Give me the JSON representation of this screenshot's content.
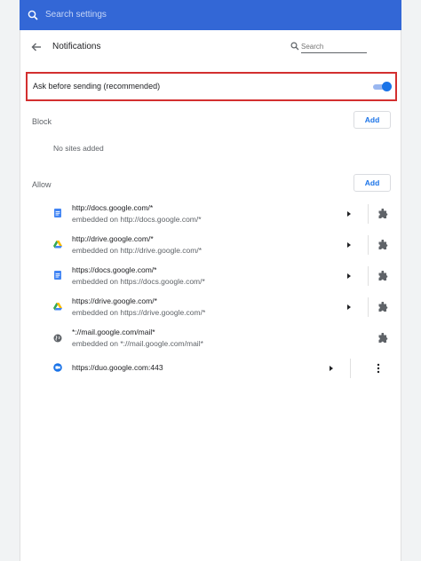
{
  "topbar": {
    "search_placeholder": "Search settings"
  },
  "header": {
    "title": "Notifications",
    "search_placeholder": "Search"
  },
  "ask": {
    "label": "Ask before sending (recommended)",
    "enabled": true
  },
  "block": {
    "title": "Block",
    "add_label": "Add",
    "empty_text": "No sites added"
  },
  "allow": {
    "title": "Allow",
    "add_label": "Add",
    "sites": [
      {
        "url": "http://docs.google.com/*",
        "embedded": "embedded on http://docs.google.com/*",
        "icon": "google-docs-icon"
      },
      {
        "url": "http://drive.google.com/*",
        "embedded": "embedded on http://drive.google.com/*",
        "icon": "google-drive-icon"
      },
      {
        "url": "https://docs.google.com/*",
        "embedded": "embedded on https://docs.google.com/*",
        "icon": "google-docs-icon"
      },
      {
        "url": "https://drive.google.com/*",
        "embedded": "embedded on https://drive.google.com/*",
        "icon": "google-drive-icon"
      },
      {
        "url": "*://mail.google.com/mail*",
        "embedded": "embedded on *://mail.google.com/mail*",
        "icon": "globe-icon"
      },
      {
        "url": "https://duo.google.com:443",
        "embedded": "",
        "icon": "google-duo-icon"
      }
    ]
  },
  "colors": {
    "topbar": "#3367d6",
    "accent": "#1a73e8",
    "highlight_border": "#d32f2f"
  }
}
